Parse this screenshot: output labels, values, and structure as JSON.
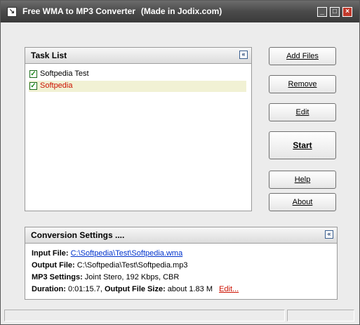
{
  "window": {
    "title": "Free WMA to MP3 Converter",
    "title_extra": "(Made in Jodix.com)",
    "minimize": "_",
    "maximize": "□",
    "close": "×"
  },
  "task_list": {
    "title": "Task List",
    "collapse_glyph": "«",
    "items": [
      {
        "label": "Softpedia Test",
        "checked": true,
        "selected": false
      },
      {
        "label": "Softpedia",
        "checked": true,
        "selected": true
      }
    ]
  },
  "buttons": {
    "add_files": "Add Files",
    "remove": "Remove",
    "edit": "Edit",
    "start": "Start",
    "help": "Help",
    "about": "About"
  },
  "conversion": {
    "title": "Conversion Settings ....",
    "collapse_glyph": "«",
    "input_label": "Input File:",
    "input_value": "C:\\Softpedia\\Test\\Softpedia.wma",
    "output_label": "Output File:",
    "output_value": "C:\\Softpedia\\Test\\Softpedia.mp3",
    "mp3_label": "MP3 Settings:",
    "mp3_value": "Joint Stero, 192 Kbps, CBR",
    "duration_label": "Duration:",
    "duration_value": "0:01:15.7,",
    "size_label": "Output File Size:",
    "size_value": "about 1.83 M",
    "edit_link": "Edit..."
  },
  "colors": {
    "accent_link": "#0033cc",
    "selected_text": "#cc1100",
    "selected_row": "#f1f1d4"
  }
}
